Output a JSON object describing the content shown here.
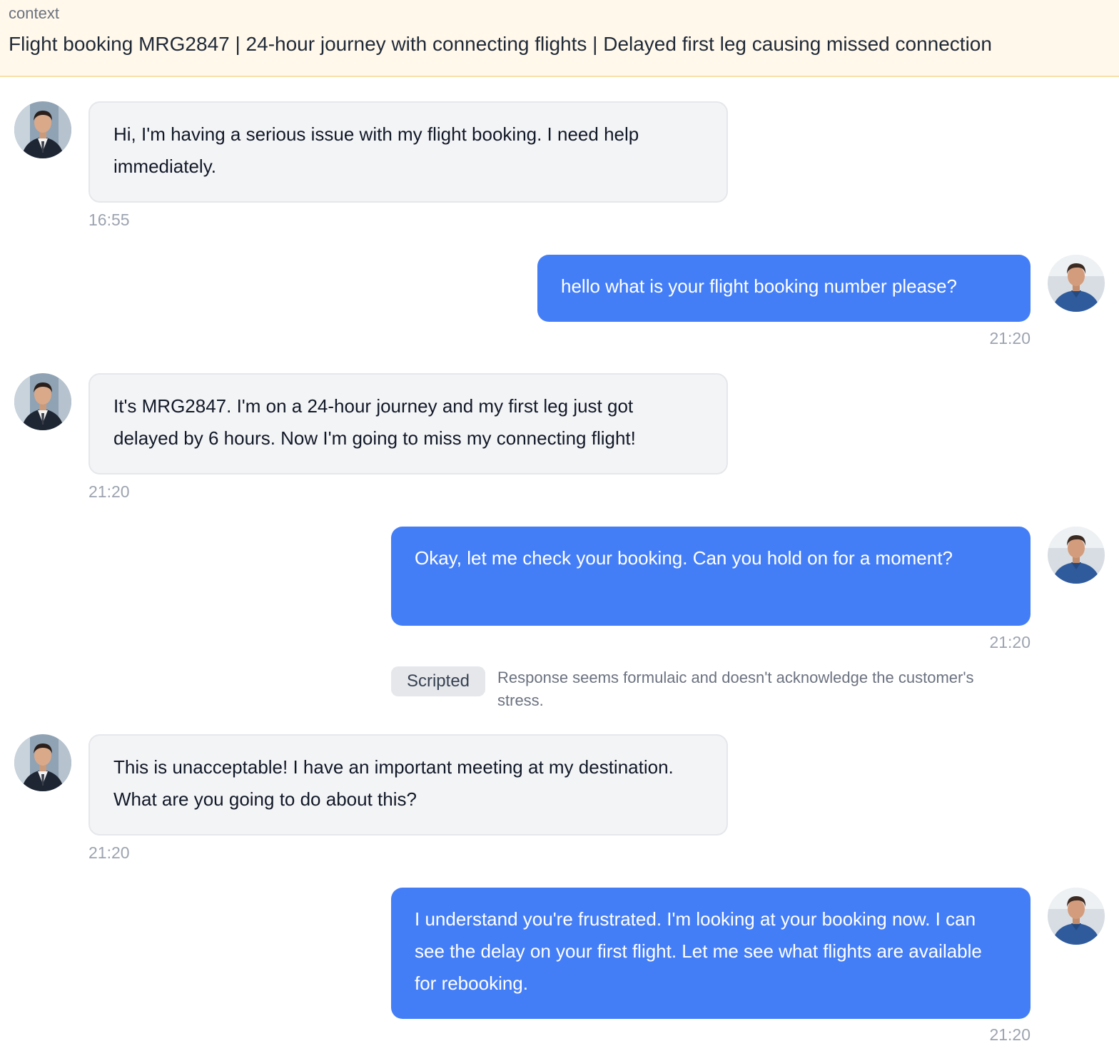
{
  "context": {
    "label": "context",
    "text": "Flight booking MRG2847 | 24-hour journey with connecting flights | Delayed first leg causing missed connection"
  },
  "messages": [
    {
      "role": "customer",
      "text": "Hi, I'm having a serious issue with my flight booking. I need help immediately.",
      "time": "16:55"
    },
    {
      "role": "agent",
      "text": "hello what is your flight booking number please?",
      "time": "21:20"
    },
    {
      "role": "customer",
      "text": "It's MRG2847. I'm on a 24-hour journey and my first leg just got delayed by 6 hours. Now I'm going to miss my connecting flight!",
      "time": "21:20"
    },
    {
      "role": "agent",
      "text": "Okay, let me check your booking. Can you hold on for a moment?",
      "time": "21:20",
      "feedback": {
        "tag": "Scripted",
        "note": "Response seems formulaic and doesn't acknowledge the customer's stress."
      }
    },
    {
      "role": "customer",
      "text": "This is unacceptable! I have an important meeting at my destination. What are you going to do about this?",
      "time": "21:20"
    },
    {
      "role": "agent",
      "text": "I understand you're frustrated. I'm looking at your booking now. I can see the delay on your first flight. Let me see what flights are available for rebooking.",
      "time": "21:20"
    }
  ],
  "colors": {
    "agent_bubble": "#447ef7",
    "customer_bubble": "#f3f4f6",
    "context_background": "#fff8eb"
  },
  "icons": {
    "customer_avatar": "customer-avatar-suit",
    "agent_avatar": "agent-avatar-shirt"
  }
}
